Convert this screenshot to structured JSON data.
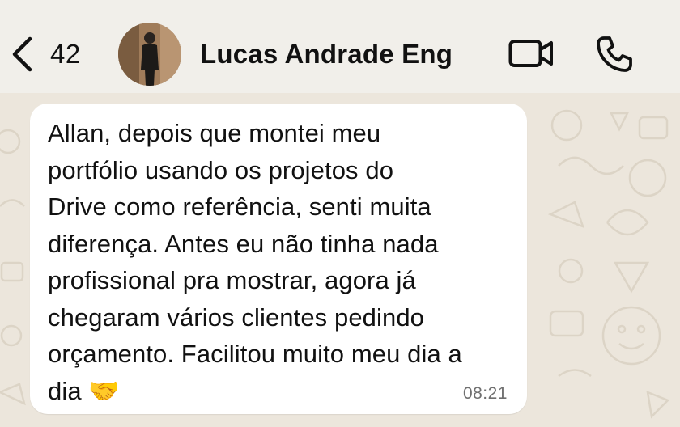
{
  "header": {
    "unread_count": "42",
    "contact_name": "Lucas Andrade Eng"
  },
  "message": {
    "text": "Allan, depois que montei meu\nportfólio usando os projetos do\nDrive como referência, senti muita\ndiferença. Antes eu não tinha nada\nprofissional pra mostrar, agora já\nchegaram vários clientes pedindo\norçamento. Facilitou muito meu dia a\ndia 🤝",
    "time": "08:21"
  },
  "icons": {
    "back": "chevron-left-icon",
    "video": "video-camera-icon",
    "call": "phone-icon",
    "emoji": "handshake-emoji"
  },
  "colors": {
    "header_bg": "#f1efea",
    "chat_bg": "#ece6dc",
    "bubble_bg": "#ffffff",
    "time_text": "#6f6f6f"
  }
}
